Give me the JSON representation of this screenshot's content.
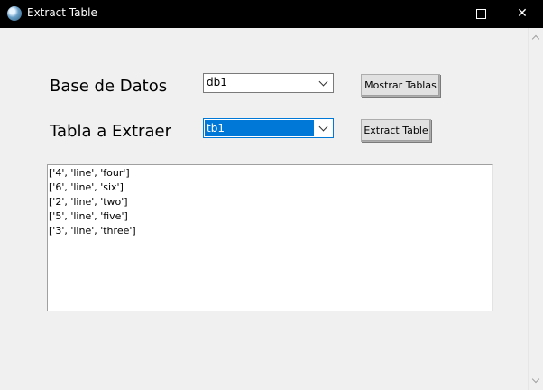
{
  "window": {
    "title": "Extract Table",
    "icon": "app-icon"
  },
  "form": {
    "db_label": "Base de Datos",
    "db_value": "db1",
    "mostrar_button": "Mostrar Tablas",
    "table_label": "Tabla a Extraer",
    "table_value": "tb1",
    "extract_button": "Extract Table"
  },
  "output": {
    "lines": [
      "['4', 'line', 'four']",
      "['6', 'line', 'six']",
      "['2', 'line', 'two']",
      "['5', 'line', 'five']",
      "['3', 'line', 'three']"
    ]
  },
  "colors": {
    "selection": "#0078d7",
    "titlebar": "#000000",
    "background": "#f0f0f0"
  }
}
